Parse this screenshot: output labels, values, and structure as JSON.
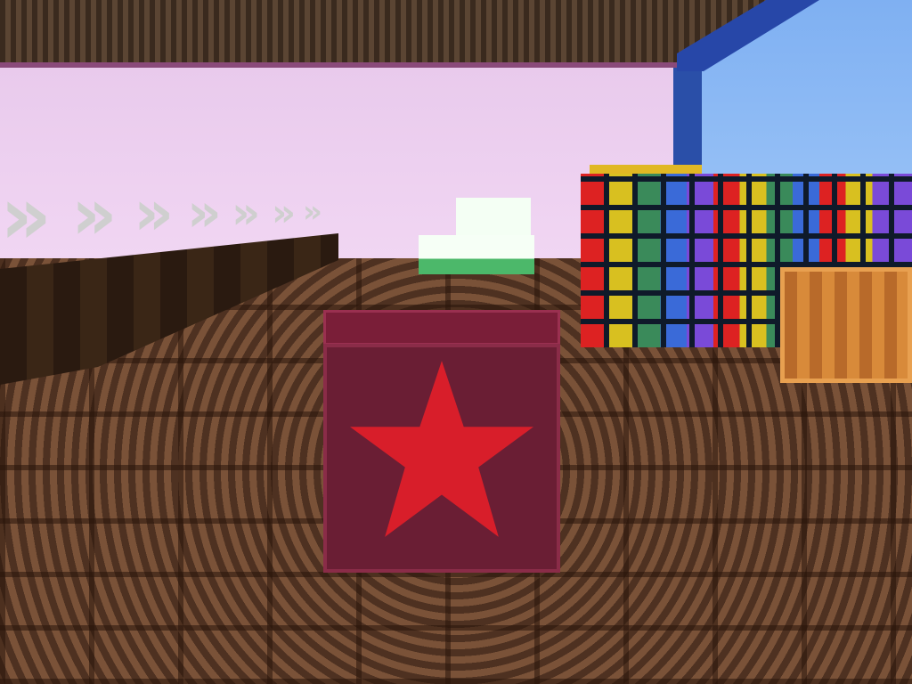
{
  "scene": {
    "type": "voxel-game-view",
    "colors": {
      "sky": "#e6c6ea",
      "blue_wall": "#8fbaf4",
      "floor": "#6a4530",
      "star_block": "#6a1e34",
      "star": "#d81e2a"
    }
  }
}
